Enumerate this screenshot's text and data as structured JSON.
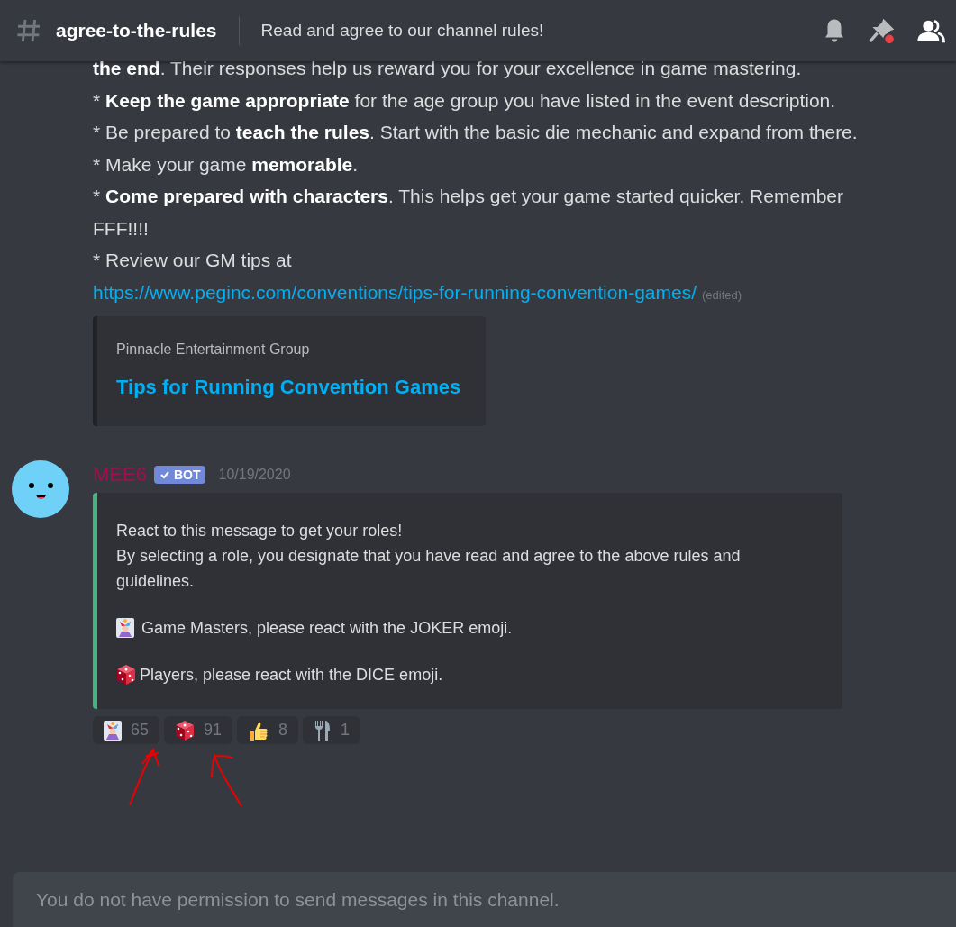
{
  "header": {
    "channel": "agree-to-the-rules",
    "topic": "Read and agree to our channel rules!"
  },
  "messages": [
    {
      "kind": "continuation",
      "lines": [
        "**the end**. Their responses help us reward you for your excellence in game mastering.",
        "* **Keep the game appropriate** for the age group you have listed in the event description.",
        "* Be prepared to **teach the rules**. Start with the basic die mechanic and expand from there.",
        "* Make your game **memorable**.",
        "* **Come prepared with characters**. This helps get your game started quicker. Remember FFF!!!!"
      ],
      "link_line": {
        "text": "* Review our GM tips at ",
        "link": "https://www.peginc.com/conventions/tips-for-running-convention-games/",
        "edited": "(edited)"
      },
      "embed": {
        "provider": "Pinnacle Entertainment Group",
        "title": "Tips for Running Convention Games"
      }
    },
    {
      "kind": "bot",
      "author": "MEE6",
      "badge": "BOT",
      "timestamp": "10/19/2020",
      "embed": {
        "color": "#43b581",
        "paragraphs": [
          {
            "kind": "plain",
            "lines": [
              "React to this message to get your roles!",
              "By selecting a role, you designate that you have read and agree to the above rules and guidelines."
            ]
          },
          {
            "kind": "joker",
            "lines": [
              "Game Masters, please react with the JOKER emoji."
            ]
          },
          {
            "kind": "dice",
            "lines": [
              "Players, please react with the DICE emoji."
            ]
          }
        ]
      },
      "reactions": [
        {
          "kind": "joker",
          "count": "65"
        },
        {
          "kind": "dice",
          "count": "91"
        },
        {
          "kind": "thumbsup",
          "count": "8"
        },
        {
          "kind": "forkknife",
          "count": "1"
        }
      ]
    }
  ],
  "composer": {
    "placeholder": "You do not have permission to send messages in this channel."
  }
}
